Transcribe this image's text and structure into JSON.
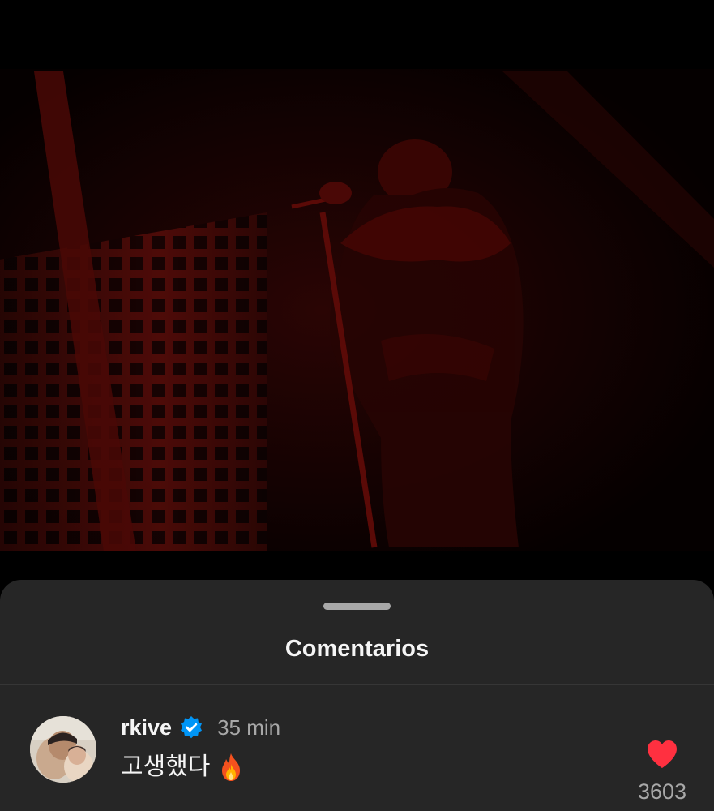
{
  "media": {
    "description_icon": "concert-photo"
  },
  "comments_sheet": {
    "title": "Comentarios",
    "comments": [
      {
        "username": "rkive",
        "verified": true,
        "time": "35 min",
        "text": "고생했다",
        "emoji_icon": "fire-icon",
        "liked": true,
        "like_count": "3603"
      }
    ]
  },
  "colors": {
    "sheet_background": "#262626",
    "heart": "#ff3040",
    "verified_badge": "#0095f6",
    "text_primary": "#f5f5f5",
    "text_secondary": "#a8a8a8"
  }
}
